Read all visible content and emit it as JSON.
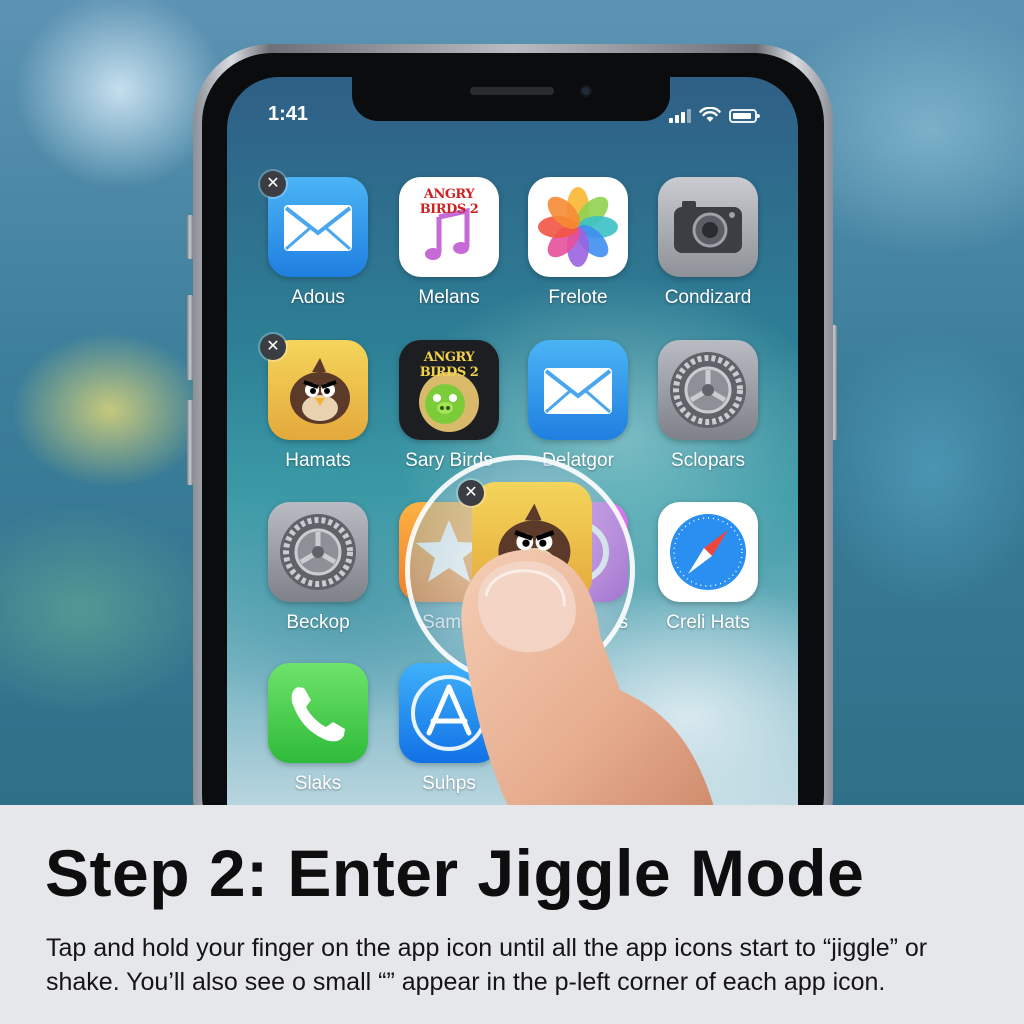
{
  "status_bar": {
    "time": "1:41"
  },
  "apps": [
    {
      "label": "Adous",
      "icon": "mail-icon",
      "badge": "✕"
    },
    {
      "label": "Melans",
      "icon": "music-note-icon",
      "title": "ANGRY BIRDS 2"
    },
    {
      "label": "Frelote",
      "icon": "photos-flower-icon"
    },
    {
      "label": "Condizard",
      "icon": "camera-icon"
    },
    {
      "label": "Hamats",
      "icon": "angry-bird-icon",
      "badge": "✕"
    },
    {
      "label": "Sary Birds",
      "icon": "angry-birds-pig-icon",
      "title": "ANGRY BIRDS 2"
    },
    {
      "label": "Delatgor",
      "icon": "mail-icon"
    },
    {
      "label": "Sclopars",
      "icon": "settings-gear-icon"
    },
    {
      "label": "Beckop",
      "icon": "settings-gear-icon"
    },
    {
      "label": "Samle",
      "icon": "star-icon"
    },
    {
      "label": "s",
      "icon": "purple-app-icon"
    },
    {
      "label": "Creli Hats",
      "icon": "compass-icon"
    },
    {
      "label": "Slaks",
      "icon": "phone-icon"
    },
    {
      "label": "Suhps",
      "icon": "app-store-icon"
    }
  ],
  "magnifier": {
    "badge": "✕",
    "icon": "angry-bird-icon"
  },
  "caption": {
    "title": "Step 2: Enter Jiggle Mode",
    "body": "Tap and hold your finger on the app icon until all the app icons start to “jiggle” or shake. You’ll also see o small “” appear in the p-left corner of each app icon."
  },
  "colors": {
    "caption_bg": "#e6e7ea",
    "badge_bg": "#3b3d42",
    "mail_blue": "#1f7fe0"
  }
}
